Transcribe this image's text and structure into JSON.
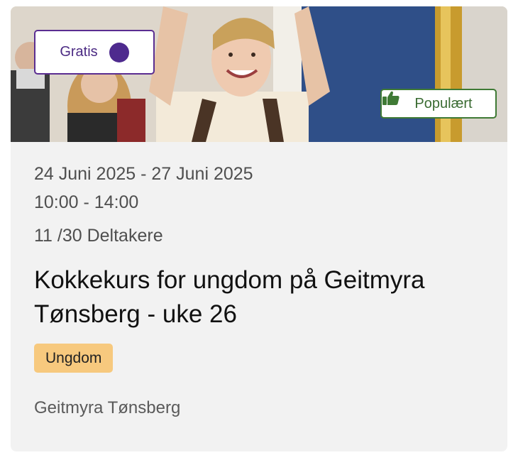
{
  "card": {
    "badges": {
      "free_label": "Gratis",
      "popular_label": "Populært"
    },
    "date_range": "24 Juni 2025 - 27 Juni 2025",
    "time_range": "10:00 - 14:00",
    "participants": "11 /30 Deltakere",
    "title": "Kokkekurs for ungdom på Geitmyra Tønsberg - uke 26",
    "tag": "Ungdom",
    "location": "Geitmyra Tønsberg"
  },
  "colors": {
    "free_badge": "#5a2d91",
    "popular_badge": "#3f7a35",
    "tag_bg": "#f7c97e",
    "card_bg": "#f2f2f2"
  },
  "icons": {
    "free_badge_icon": "check-circle-icon",
    "popular_badge_icon": "thumbs-up-icon"
  }
}
